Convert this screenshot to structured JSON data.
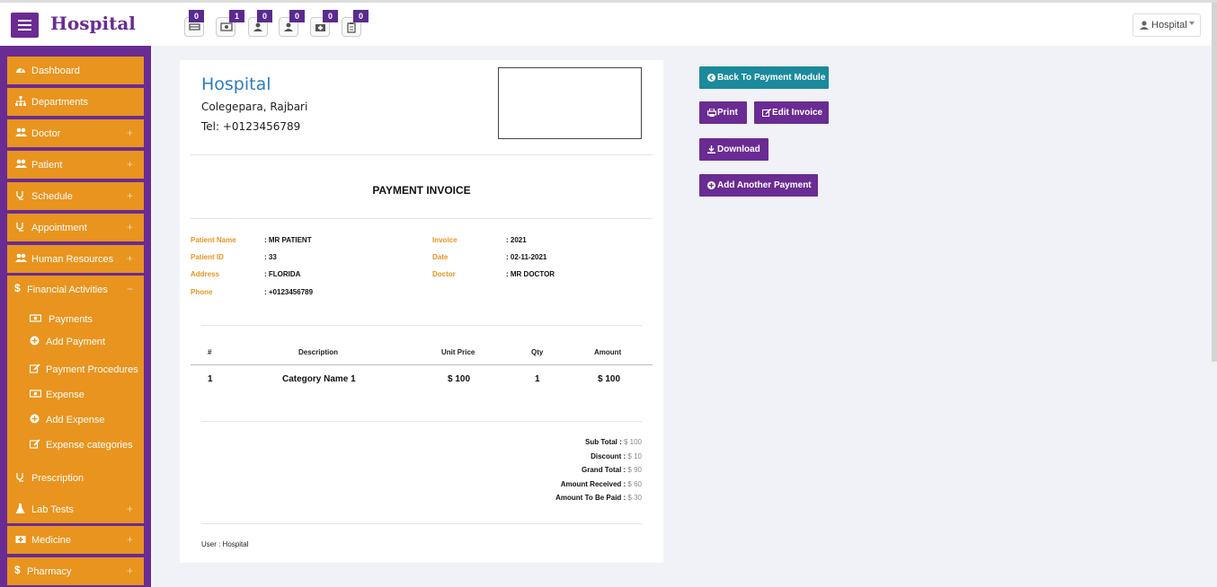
{
  "header": {
    "brand": "Hospital",
    "user_label": "Hospital",
    "notifications": [
      {
        "icon": "bed-icon",
        "count": "0"
      },
      {
        "icon": "money-icon",
        "count": "1"
      },
      {
        "icon": "user-icon",
        "count": "0"
      },
      {
        "icon": "user-icon",
        "count": "0"
      },
      {
        "icon": "medkit-icon",
        "count": "0"
      },
      {
        "icon": "clipboard-icon",
        "count": "0"
      }
    ]
  },
  "sidebar": {
    "items": [
      {
        "label": "Dashboard",
        "icon": "dashboard-icon"
      },
      {
        "label": "Departments",
        "icon": "sitemap-icon"
      },
      {
        "label": "Doctor",
        "icon": "users-icon",
        "expand": "+"
      },
      {
        "label": "Patient",
        "icon": "users-icon",
        "expand": "+"
      },
      {
        "label": "Schedule",
        "icon": "stethoscope-icon",
        "expand": "+"
      },
      {
        "label": "Appointment",
        "icon": "stethoscope-icon",
        "expand": "+"
      },
      {
        "label": "Human Resources",
        "icon": "users-icon",
        "expand": "+"
      },
      {
        "label": "Prescription",
        "icon": "stethoscope-icon"
      },
      {
        "label": "Lab Tests",
        "icon": "flask-icon",
        "expand": "+"
      },
      {
        "label": "Medicine",
        "icon": "medkit-icon",
        "expand": "+"
      },
      {
        "label": "Pharmacy",
        "icon": "dollar-icon",
        "expand": "+"
      }
    ],
    "financial": {
      "label": "Financial Activities",
      "collapse": "−",
      "subitems": [
        {
          "label": "Payments",
          "icon": "money-icon"
        },
        {
          "label": "Add Payment",
          "icon": "plus-circle-icon"
        },
        {
          "label": "Payment Procedures",
          "icon": "edit-icon"
        },
        {
          "label": "Expense",
          "icon": "money-icon"
        },
        {
          "label": "Add Expense",
          "icon": "plus-circle-icon"
        },
        {
          "label": "Expense categories",
          "icon": "edit-icon"
        }
      ]
    }
  },
  "invoice": {
    "hospital_name": "Hospital",
    "address": "Colegepara, Rajbari",
    "tel": "Tel: +0123456789",
    "title": "PAYMENT INVOICE",
    "patient_name_label": "Patient Name",
    "patient_name": ": MR PATIENT",
    "patient_id_label": "Patient ID",
    "patient_id": ": 33",
    "address_label": "Address",
    "patient_address": ": FLORIDA",
    "phone_label": "Phone",
    "phone": ": +0123456789",
    "invoice_label": "Invoice",
    "invoice_no": ": 2021",
    "date_label": "Date",
    "date": ": 02-11-2021",
    "doctor_label": "Doctor",
    "doctor": ": MR DOCTOR",
    "table": {
      "headers": [
        "#",
        "Description",
        "Unit Price",
        "Qty",
        "Amount"
      ],
      "rows": [
        [
          "1",
          "Category Name 1",
          "$ 100",
          "1",
          "$ 100"
        ]
      ]
    },
    "totals": {
      "sub_total_label": "Sub Total :",
      "sub_total": " $ 100",
      "discount_label": "Discount :",
      "discount": " $ 10",
      "grand_total_label": "Grand Total :",
      "grand_total": " $ 90",
      "amount_received_label": "Amount Received :",
      "amount_received": " $ 60",
      "amount_to_be_paid_label": "Amount To Be Paid :",
      "amount_to_be_paid": " $ 30"
    },
    "user_line": "User : Hospital"
  },
  "actions": {
    "back": "Back To Payment Module",
    "print": "Print",
    "edit": "Edit Invoice",
    "download": "Download",
    "add_another": "Add Another Payment"
  },
  "colors": {
    "primary": "#6a2b93",
    "sidebar_item": "#e8941f",
    "teal": "#1a8a9c",
    "link_blue": "#2c7cc1"
  }
}
